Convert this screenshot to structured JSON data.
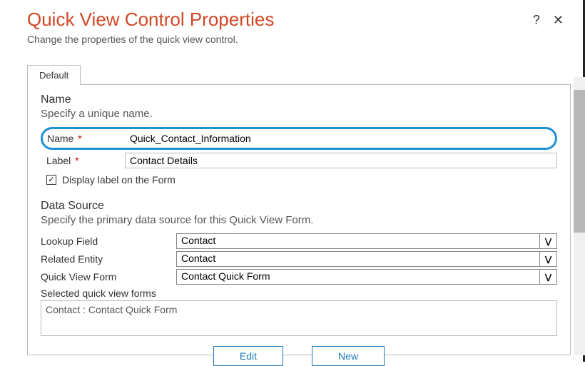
{
  "header": {
    "title": "Quick View Control Properties",
    "subtitle": "Change the properties of the quick view control."
  },
  "tabs": [
    {
      "label": "Default"
    }
  ],
  "name_section": {
    "heading": "Name",
    "description": "Specify a unique name.",
    "name_label": "Name",
    "name_value": "Quick_Contact_Information",
    "label_label": "Label",
    "label_value": "Contact Details",
    "display_label_text": "Display label on the Form",
    "display_label_checked": true
  },
  "data_source": {
    "heading": "Data Source",
    "description": "Specify the primary data source for this Quick View Form.",
    "lookup_field_label": "Lookup Field",
    "lookup_field_value": "Contact",
    "related_entity_label": "Related Entity",
    "related_entity_value": "Contact",
    "quick_view_form_label": "Quick View Form",
    "quick_view_form_value": "Contact Quick Form",
    "selected_forms_label": "Selected quick view forms",
    "selected_forms_value": "Contact : Contact Quick Form"
  },
  "buttons": {
    "edit": "Edit",
    "new": "New"
  },
  "required_marker": "*",
  "checkmark": "✓"
}
